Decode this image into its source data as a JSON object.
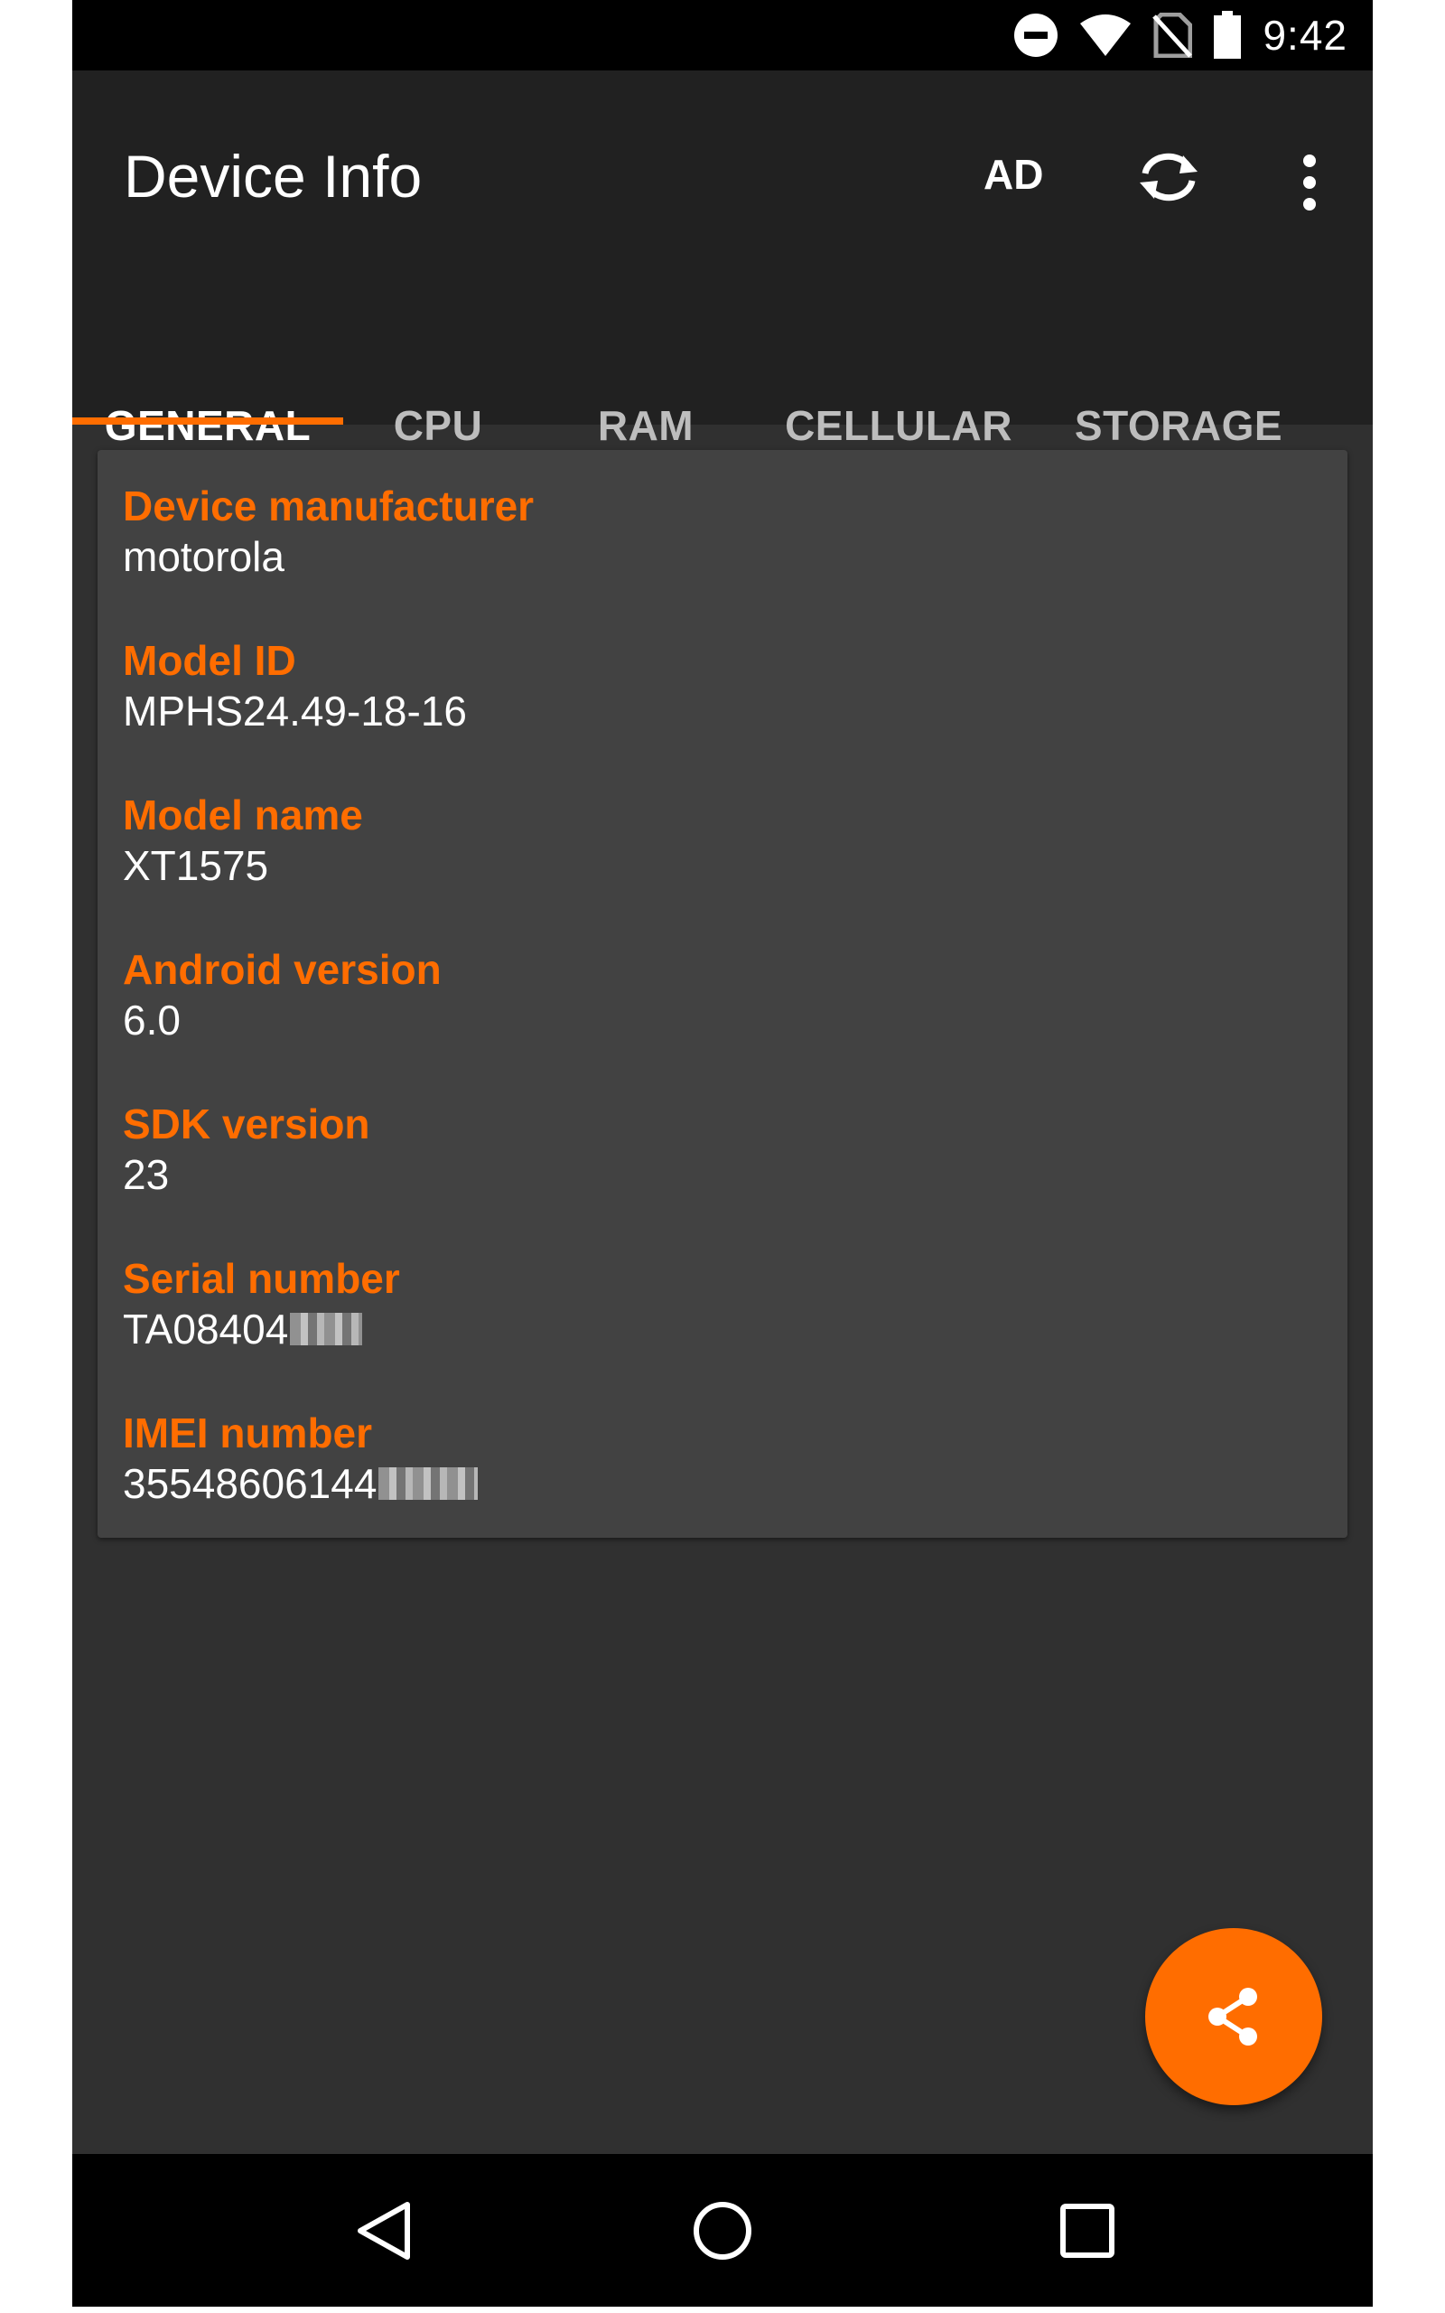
{
  "status_bar": {
    "time": "9:42",
    "icons": [
      "do-not-disturb-icon",
      "wifi-icon",
      "no-sim-icon",
      "battery-icon"
    ]
  },
  "app_bar": {
    "title": "Device Info",
    "ad_label": "AD",
    "actions": [
      "refresh-icon",
      "overflow-menu-icon"
    ]
  },
  "tabs": [
    {
      "label": "GENERAL",
      "active": true
    },
    {
      "label": "CPU",
      "active": false
    },
    {
      "label": "RAM",
      "active": false
    },
    {
      "label": "CELLULAR",
      "active": false
    },
    {
      "label": "STORAGE",
      "active": false
    }
  ],
  "fields": [
    {
      "label": "Device manufacturer",
      "value": "motorola"
    },
    {
      "label": "Model ID",
      "value": "MPHS24.49-18-16"
    },
    {
      "label": "Model name",
      "value": "XT1575"
    },
    {
      "label": "Android version",
      "value": "6.0"
    },
    {
      "label": "SDK version",
      "value": "23"
    },
    {
      "label": "Serial number",
      "value": "TA08404"
    },
    {
      "label": "IMEI number",
      "value": "35548606144"
    }
  ],
  "fab": {
    "icon": "share-icon"
  },
  "nav_bar": {
    "buttons": [
      "back-icon",
      "home-icon",
      "recents-icon"
    ]
  },
  "colors": {
    "accent": "#ff6d00",
    "app_bar": "#212121",
    "background": "#303030",
    "card": "#424242"
  }
}
